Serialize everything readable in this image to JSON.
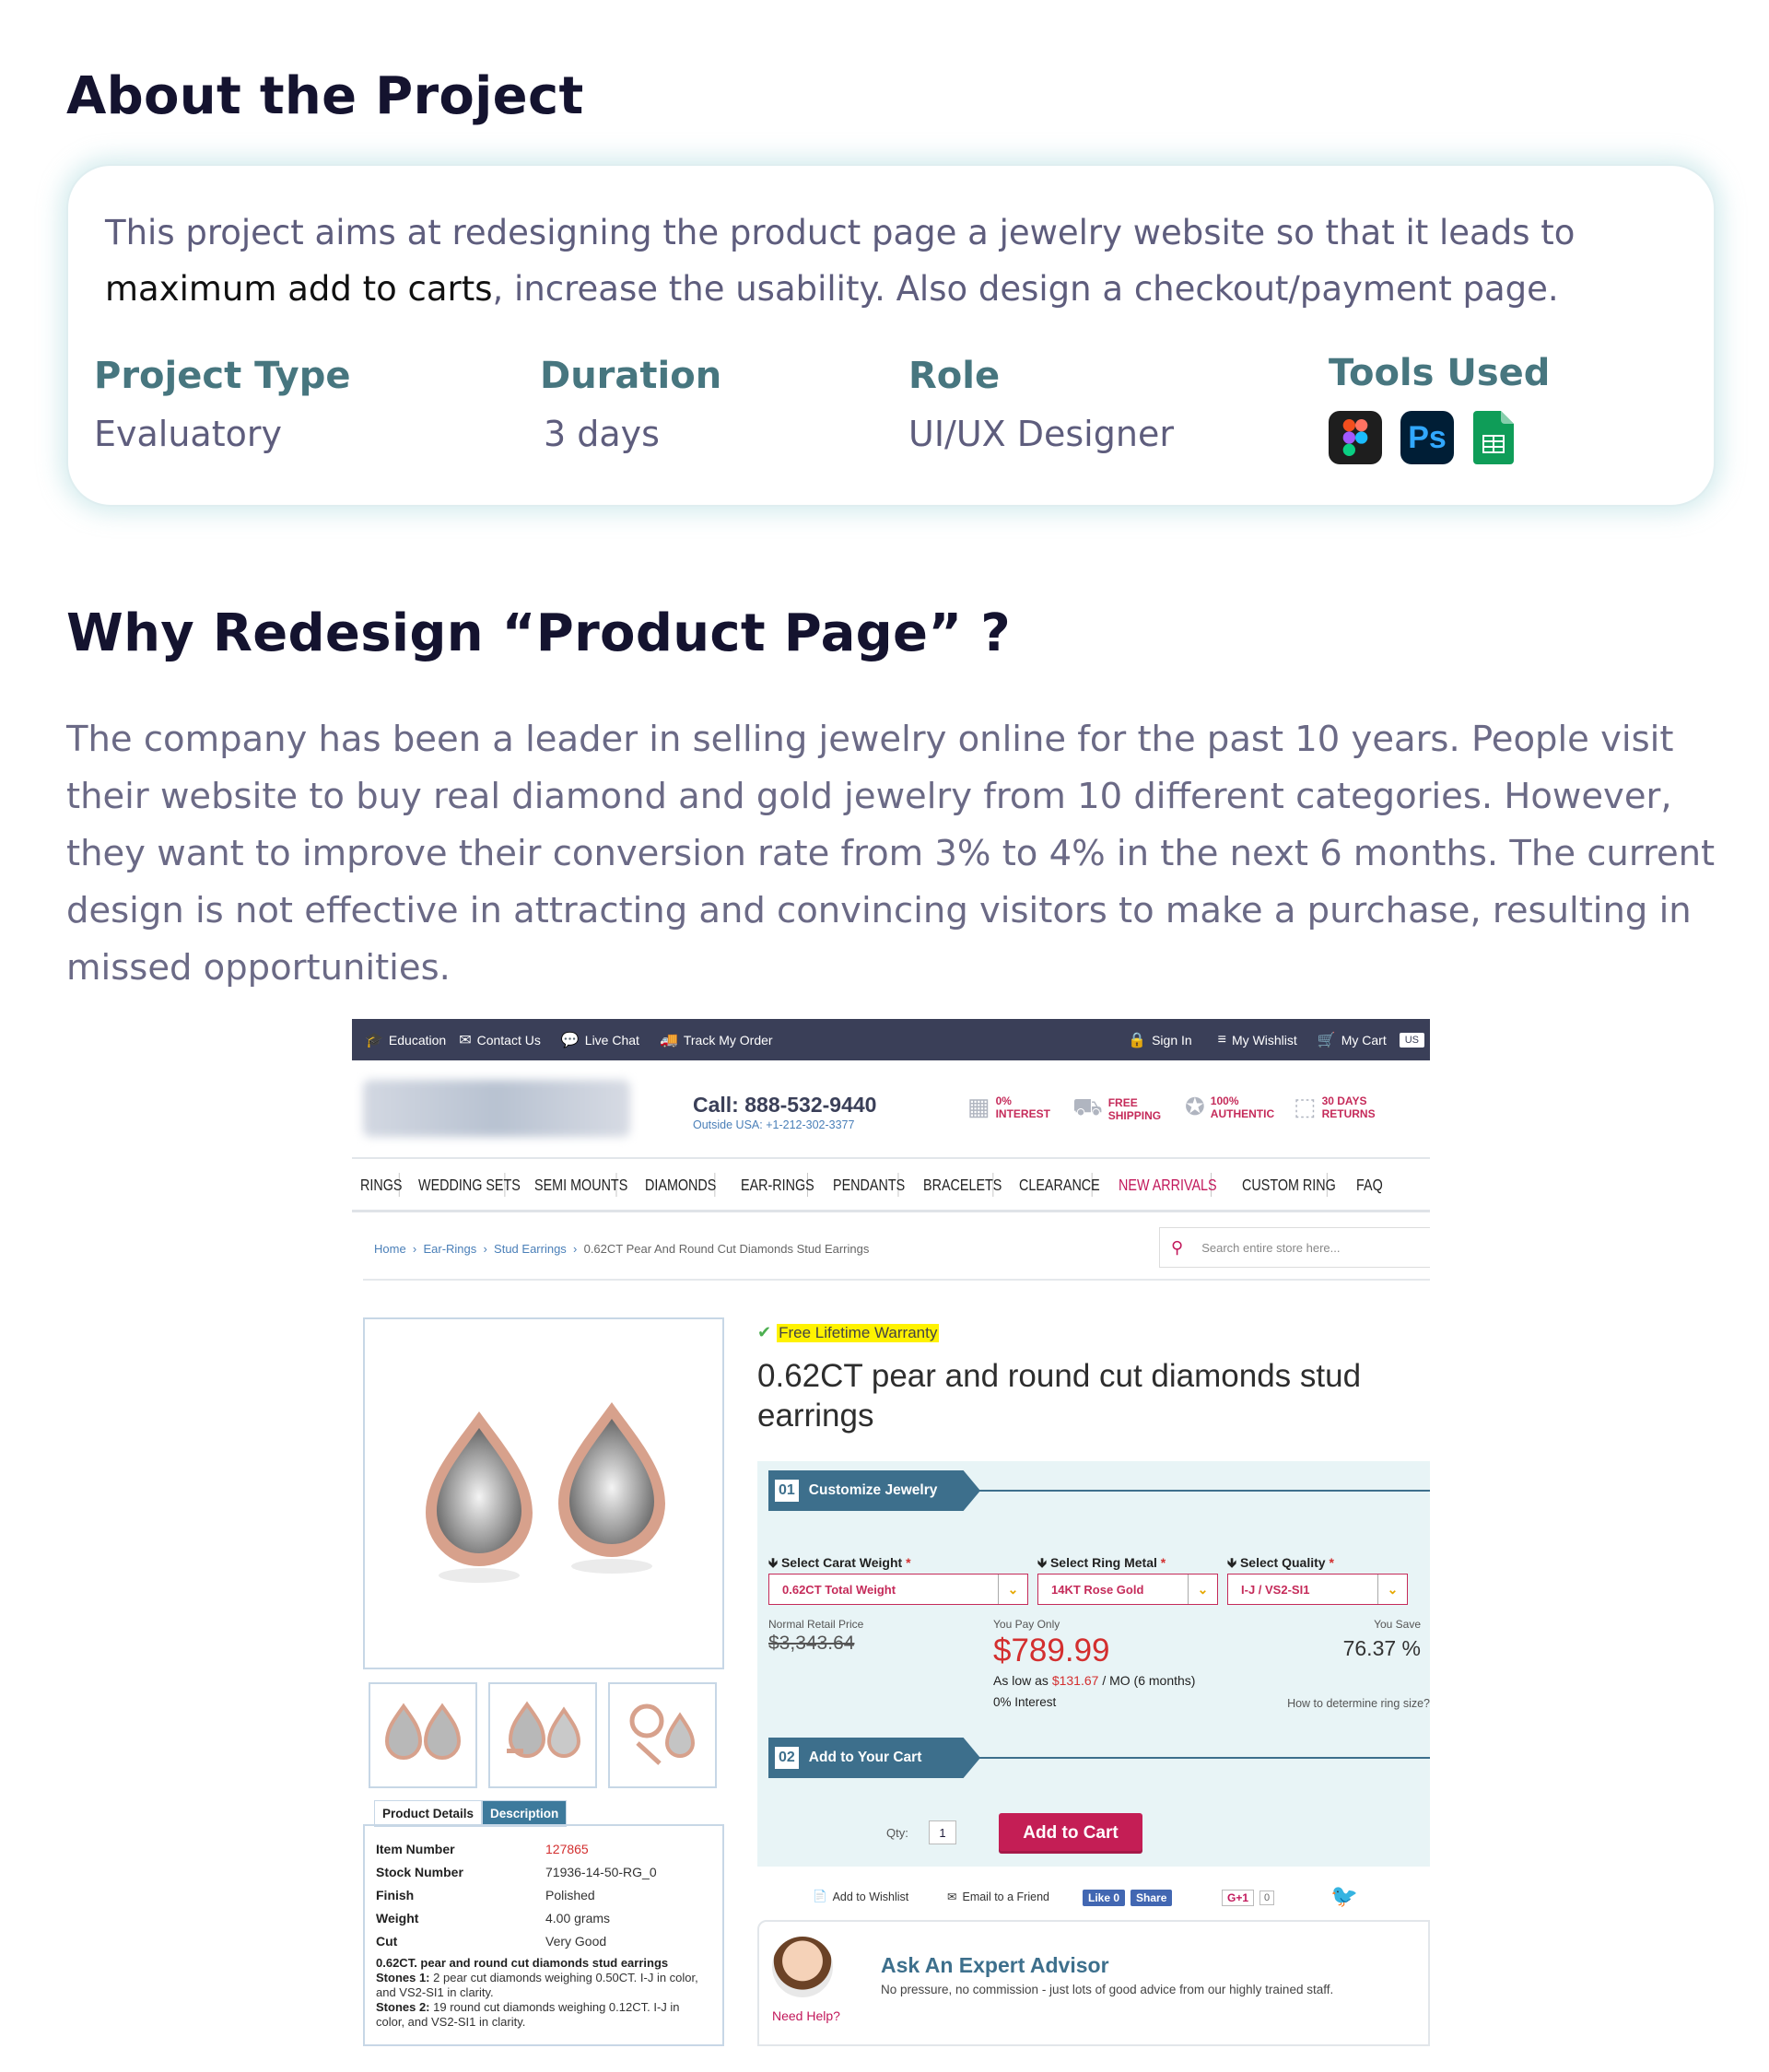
{
  "about": {
    "heading": "About the Project",
    "intro_part1": "This project aims at redesigning the product page a jewelry website so that it leads to",
    "intro_strong": "maximum add to carts",
    "intro_part2": ", increase the usability. Also design a checkout/payment page.",
    "meta": [
      {
        "label": "Project Type",
        "value": "Evaluatory"
      },
      {
        "label": "Duration",
        "value": "3 days"
      },
      {
        "label": "Role",
        "value": "UI/UX Designer"
      }
    ],
    "tools_label": "Tools Used",
    "tools": [
      {
        "name": "figma-icon"
      },
      {
        "name": "photoshop-icon",
        "text": "Ps"
      },
      {
        "name": "google-sheets-icon"
      }
    ]
  },
  "why": {
    "heading": "Why Redesign “Product Page” ?",
    "paragraph": "The company has been a leader in selling jewelry online for the past 10 years. People visit their website to buy real diamond and gold jewelry from 10 different categories. However, they want to improve their conversion rate from 3% to 4% in the next 6 months. The current design is not effective in attracting and convincing visitors to make a purchase, resulting in missed opportunities."
  },
  "shot": {
    "topbar": {
      "left": [
        "Education",
        "Contact Us",
        "Live Chat",
        "Track My Order"
      ],
      "right": [
        "Sign In",
        "My Wishlist",
        "My Cart"
      ],
      "flag": "US"
    },
    "call": "Call: 888-532-9440",
    "call_sub": "Outside USA: +1-212-302-3377",
    "badges": [
      "0% INTEREST",
      "FREE SHIPPING",
      "100% AUTHENTIC",
      "30 DAYS RETURNS"
    ],
    "nav": [
      "RINGS",
      "WEDDING SETS",
      "SEMI MOUNTS",
      "DIAMONDS",
      "EAR-RINGS",
      "PENDANTS",
      "BRACELETS",
      "CLEARANCE",
      "NEW ARRIVALS",
      "CUSTOM RING",
      "FAQ"
    ],
    "breadcrumb": [
      "Home",
      "Ear-Rings",
      "Stud Earrings"
    ],
    "breadcrumb_current": "0.62CT Pear And Round Cut Diamonds Stud Earrings",
    "search_placeholder": "Search entire store here...",
    "warranty": "Free Lifetime Warranty",
    "title": "0.62CT pear and round cut diamonds stud earrings",
    "step1": {
      "num": "01",
      "label": "Customize Jewelry"
    },
    "selects": [
      {
        "label": "Select Carat Weight",
        "value": "0.62CT Total Weight"
      },
      {
        "label": "Select Ring Metal",
        "value": "14KT Rose Gold"
      },
      {
        "label": "Select Quality",
        "value": "I-J / VS2-SI1"
      }
    ],
    "price": {
      "normal_label": "Normal Retail Price",
      "normal": "$3,343.64",
      "pay_label": "You Pay Only",
      "pay": "$789.99",
      "aslow_prefix": "As low as",
      "aslow_amount": "$131.67",
      "aslow_suffix": "/ MO (6 months)",
      "interest": "0% Interest",
      "save_label": "You Save",
      "save": "76.37 %",
      "ring_size": "How to determine ring size?"
    },
    "step2": {
      "num": "02",
      "label": "Add to Your Cart"
    },
    "qty_label": "Qty:",
    "qty": "1",
    "add_to_cart": "Add to Cart",
    "share": {
      "wishlist": "Add to Wishlist",
      "email": "Email to a Friend",
      "like": "Like 0",
      "share": "Share",
      "gplus": "G+1",
      "gcount": "0"
    },
    "tabs": [
      "Product Details",
      "Description"
    ],
    "details": [
      {
        "k": "Item Number",
        "v": "127865"
      },
      {
        "k": "Stock Number",
        "v": "71936-14-50-RG_0"
      },
      {
        "k": "Finish",
        "v": "Polished"
      },
      {
        "k": "Weight",
        "v": "4.00 grams"
      },
      {
        "k": "Cut",
        "v": "Very Good"
      }
    ],
    "detail_title": "0.62CT. pear and round cut diamonds stud earrings",
    "stones1_label": "Stones 1:",
    "stones1": "2 pear cut diamonds weighing 0.50CT. I-J in color, and VS2-SI1 in clarity.",
    "stones2_label": "Stones 2:",
    "stones2": "19 round cut diamonds weighing 0.12CT. I-J in color, and VS2-SI1 in clarity.",
    "expert_title": "Ask An Expert Advisor",
    "expert_sub": "No pressure, no commission - just lots of good advice from our highly trained staff.",
    "need_help": "Need Help?",
    "colors": {
      "accent": "#c41e55",
      "bar": "#3a3f58",
      "step": "#3d6f8c",
      "panel": "#e8f4f6"
    }
  }
}
